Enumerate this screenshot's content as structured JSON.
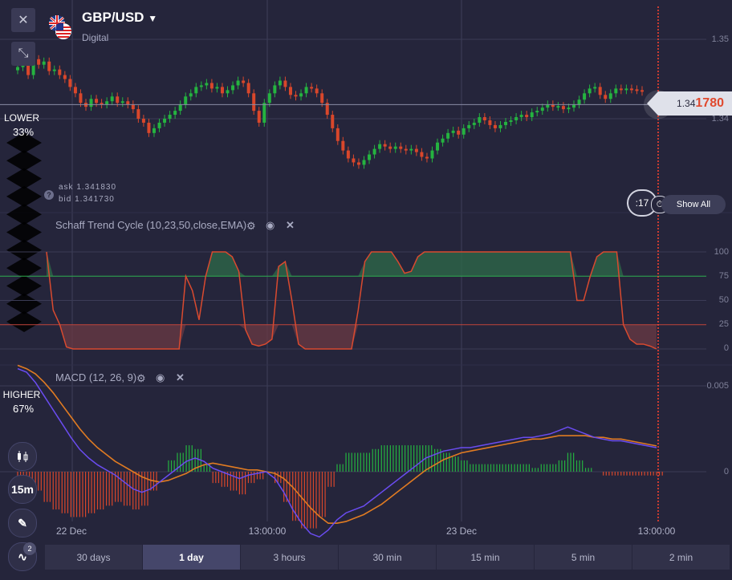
{
  "header": {
    "pair": "GBP/USD",
    "type": "Digital",
    "close_icon": "close-icon",
    "collapse_icon": "collapse-arrows-icon",
    "flag_icon": "gb-us-flag-icon",
    "dropdown_icon": "caret-down-icon"
  },
  "sentiment": {
    "lower_label": "LOWER",
    "lower_pct": "33%",
    "higher_label": "HIGHER",
    "higher_pct": "67%",
    "lower_color": "#6e3a3e",
    "higher_color": "#1f8c3a"
  },
  "quote": {
    "ask": "ask 1.341830",
    "bid": "bid 1.341730",
    "help_icon": "question-icon",
    "price_base": "1.34",
    "price_highlight": "1780"
  },
  "price_axis": [
    "1.35",
    "1.34"
  ],
  "indicators": {
    "stc": {
      "title": "Schaff Trend Cycle (10,23,50,close,EMA)",
      "axis": [
        "100",
        "75",
        "50",
        "25",
        "0"
      ]
    },
    "macd": {
      "title": "MACD (12, 26, 9)",
      "axis": [
        "0.005",
        "0"
      ]
    }
  },
  "x_axis": [
    "22 Dec",
    "13:00:00",
    "23 Dec",
    "13:00:00"
  ],
  "timer": ":17",
  "show_all": "Show All",
  "tools": {
    "timeframe": "15m",
    "indicator_count": "2"
  },
  "timeframes": [
    {
      "label": "30 days",
      "active": false
    },
    {
      "label": "1 day",
      "active": true
    },
    {
      "label": "3 hours",
      "active": false
    },
    {
      "label": "30 min",
      "active": false
    },
    {
      "label": "15 min",
      "active": false
    },
    {
      "label": "5 min",
      "active": false
    },
    {
      "label": "2 min",
      "active": false
    }
  ],
  "colors": {
    "background": "#25253b",
    "up_candle": "#25b340",
    "down_candle": "#d9472b",
    "expiry_line": "#ff4530",
    "macd_line": "#6a4cf0",
    "signal_line": "#e07b22",
    "stc_line": "#d94a2f",
    "stc_upper_fill": "#2e6b4a",
    "stc_lower_fill": "#6b3a44"
  },
  "chart_data": [
    {
      "type": "candlestick",
      "title": "GBP/USD",
      "ylim": [
        1.3325,
        1.3545
      ],
      "y_ticks": [
        1.35,
        1.34
      ],
      "close_series": [
        1.3465,
        1.347,
        1.3455,
        1.3475,
        1.3468,
        1.3472,
        1.346,
        1.3462,
        1.3455,
        1.345,
        1.344,
        1.3432,
        1.342,
        1.3415,
        1.3425,
        1.342,
        1.3418,
        1.3422,
        1.3428,
        1.342,
        1.3422,
        1.3418,
        1.3412,
        1.34,
        1.3395,
        1.3382,
        1.3388,
        1.3395,
        1.34,
        1.3405,
        1.341,
        1.3418,
        1.3428,
        1.3432,
        1.344,
        1.3442,
        1.3445,
        1.3438,
        1.344,
        1.3432,
        1.3436,
        1.3442,
        1.3448,
        1.3445,
        1.3432,
        1.341,
        1.3395,
        1.342,
        1.3432,
        1.3442,
        1.3448,
        1.344,
        1.343,
        1.3428,
        1.3432,
        1.344,
        1.3438,
        1.3432,
        1.342,
        1.3405,
        1.3388,
        1.3372,
        1.336,
        1.335,
        1.3345,
        1.3342,
        1.3348,
        1.3355,
        1.3362,
        1.3368,
        1.3365,
        1.3362,
        1.3365,
        1.3362,
        1.336,
        1.3362,
        1.3358,
        1.3352,
        1.335,
        1.336,
        1.337,
        1.3375,
        1.3382,
        1.3385,
        1.338,
        1.3388,
        1.3392,
        1.3395,
        1.3402,
        1.3398,
        1.3392,
        1.3388,
        1.3392,
        1.3396,
        1.3398,
        1.3402,
        1.3405,
        1.3402,
        1.3408,
        1.341,
        1.3414,
        1.3418,
        1.3415,
        1.3416,
        1.3412,
        1.3414,
        1.3418,
        1.3424,
        1.3432,
        1.3438,
        1.344,
        1.343,
        1.3425,
        1.3432,
        1.3438,
        1.3436,
        1.3438,
        1.3437,
        1.3436,
        1.3434
      ],
      "last_price": 1.34178
    },
    {
      "type": "line",
      "title": "Schaff Trend Cycle (10,23,50,close,EMA)",
      "ylim": [
        0,
        100
      ],
      "y_ticks": [
        100,
        75,
        50,
        25,
        0
      ],
      "bands": [
        75,
        25
      ],
      "series": [
        {
          "values": [
            100,
            40,
            25,
            2,
            0,
            0,
            0,
            0,
            0,
            0,
            0,
            0,
            0,
            0,
            0,
            0,
            0,
            0,
            0,
            0,
            0,
            75,
            60,
            30,
            75,
            100,
            100,
            100,
            95,
            80,
            20,
            5,
            3,
            5,
            10,
            85,
            90,
            50,
            5,
            0,
            0,
            0,
            0,
            0,
            0,
            0,
            0,
            40,
            90,
            100,
            100,
            100,
            100,
            90,
            78,
            80,
            95,
            100,
            100,
            100,
            100,
            100,
            100,
            100,
            100,
            100,
            100,
            100,
            100,
            100,
            100,
            100,
            100,
            100,
            100,
            100,
            100,
            100,
            100,
            100,
            50,
            50,
            75,
            95,
            100,
            100,
            100,
            25,
            10,
            5,
            5,
            3,
            0
          ]
        }
      ]
    },
    {
      "type": "line",
      "title": "MACD (12, 26, 9)",
      "y_ticks": [
        0.005,
        0
      ],
      "series": [
        {
          "values": [
            0.006,
            0.0058,
            0.0052,
            0.0044,
            0.0036,
            0.0028,
            0.002,
            0.0013,
            0.0008,
            0.0004,
            0.0001,
            -0.0002,
            -0.0006,
            -0.001,
            -0.0012,
            -0.001,
            -0.0006,
            -0.0002,
            0.0002,
            0.0006,
            0.0008,
            0.0006,
            0.0002,
            0.0,
            -0.0002,
            -0.0004,
            -0.0002,
            -0.0001,
            0.0,
            -0.0004,
            -0.0012,
            -0.0022,
            -0.003,
            -0.0036,
            -0.0038,
            -0.0034,
            -0.0028,
            -0.0024,
            -0.0022,
            -0.002,
            -0.0016,
            -0.0012,
            -0.0008,
            -0.0004,
            0.0,
            0.0004,
            0.0008,
            0.001,
            0.0012,
            0.0013,
            0.0014,
            0.0014,
            0.0015,
            0.0016,
            0.0017,
            0.0018,
            0.0019,
            0.002,
            0.002,
            0.0021,
            0.0022,
            0.0024,
            0.0026,
            0.0024,
            0.0022,
            0.002,
            0.0019,
            0.0018,
            0.0018,
            0.0017,
            0.0016,
            0.0015,
            0.0014
          ]
        },
        {
          "values": [
            0.0062,
            0.006,
            0.0057,
            0.0052,
            0.0046,
            0.0039,
            0.0032,
            0.0025,
            0.0019,
            0.0014,
            0.001,
            0.0006,
            0.0003,
            0.0,
            -0.0003,
            -0.0005,
            -0.0006,
            -0.0005,
            -0.0003,
            -0.0001,
            0.0002,
            0.0004,
            0.0005,
            0.0004,
            0.0003,
            0.0002,
            0.0001,
            0.0001,
            0.0,
            -0.0001,
            -0.0004,
            -0.0009,
            -0.0015,
            -0.0021,
            -0.0026,
            -0.003,
            -0.003,
            -0.0029,
            -0.0027,
            -0.0025,
            -0.0022,
            -0.0019,
            -0.0015,
            -0.0011,
            -0.0007,
            -0.0003,
            0.0001,
            0.0004,
            0.0007,
            0.0009,
            0.0011,
            0.0012,
            0.0013,
            0.0014,
            0.0015,
            0.0016,
            0.0017,
            0.0018,
            0.0019,
            0.0019,
            0.002,
            0.0021,
            0.0021,
            0.0021,
            0.0021,
            0.002,
            0.002,
            0.0019,
            0.0019,
            0.0018,
            0.0017,
            0.0016,
            0.0015
          ]
        }
      ]
    }
  ]
}
